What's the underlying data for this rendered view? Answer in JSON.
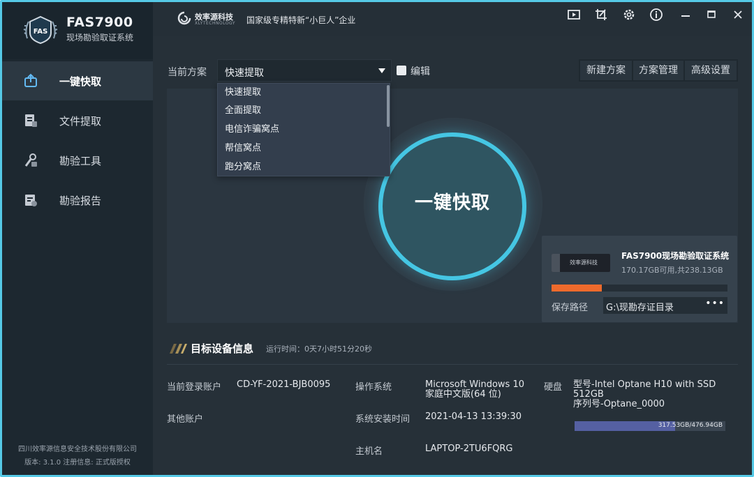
{
  "brand": {
    "title": "FAS7900",
    "subtitle": "现场勘验取证系统",
    "logo_text": "FAS"
  },
  "nav": [
    {
      "label": "一键快取",
      "icon": "quick-extract-icon",
      "active": true
    },
    {
      "label": "文件提取",
      "icon": "file-extract-icon",
      "active": false
    },
    {
      "label": "勘验工具",
      "icon": "inspection-tools-icon",
      "active": false
    },
    {
      "label": "勘验报告",
      "icon": "inspection-report-icon",
      "active": false
    }
  ],
  "footer": {
    "company": "四川效率源信息安全技术股份有限公司",
    "version": "版本: 3.1.0   注册信息: 正式版授权"
  },
  "header": {
    "company_name": "效率源科技",
    "company_eng": "XLYTECHNOLOGY",
    "slogan": "国家级专精特新“小巨人”企业",
    "icons": [
      "video-icon",
      "crop-icon",
      "settings-icon",
      "info-icon",
      "minimize-icon",
      "maximize-icon",
      "close-icon"
    ]
  },
  "scheme": {
    "label": "当前方案",
    "selected": "快速提取",
    "edit_label": "编辑",
    "options": [
      "快速提取",
      "全面提取",
      "电信诈骗窝点",
      "帮信窝点",
      "跑分窝点"
    ]
  },
  "buttons": {
    "new_scheme": "新建方案",
    "manage_scheme": "方案管理",
    "advanced": "高级设置"
  },
  "main_action": {
    "label": "一键快取"
  },
  "storage": {
    "title": "FAS7900现场勘验取证系统",
    "space": "170.17GB可用,共238.13GB",
    "drive_text": "效率源科技",
    "used_fraction": 0.285,
    "path_label": "保存路径",
    "path_value": "G:\\现勘存证目录",
    "more": "•••"
  },
  "device": {
    "title": "目标设备信息",
    "runtime": "运行时间：0天7小时51分20秒",
    "current_account_label": "当前登录账户",
    "current_account": "CD-YF-2021-BJB0095",
    "other_accounts_label": "其他账户",
    "os_label": "操作系统",
    "os_line1": "Microsoft Windows 10",
    "os_line2": "家庭中文版(64 位)",
    "install_time_label": "系统安装时间",
    "install_time": "2021-04-13 13:39:30",
    "hostname_label": "主机名",
    "hostname": "LAPTOP-2TU6FQRG",
    "disk_label": "硬盘",
    "disk_model_line1": "型号-Intel Optane H10 with SSD",
    "disk_model_line2": "512GB",
    "disk_serial": "序列号-Optane_0000",
    "disk_usage_text": "317.53GB/476.94GB",
    "disk_used_fraction": 0.666
  },
  "colors": {
    "accent": "#45c6e3",
    "progress": "#ee6a2c",
    "disk_fill": "#5560a2",
    "frame": "#55c9e6"
  }
}
